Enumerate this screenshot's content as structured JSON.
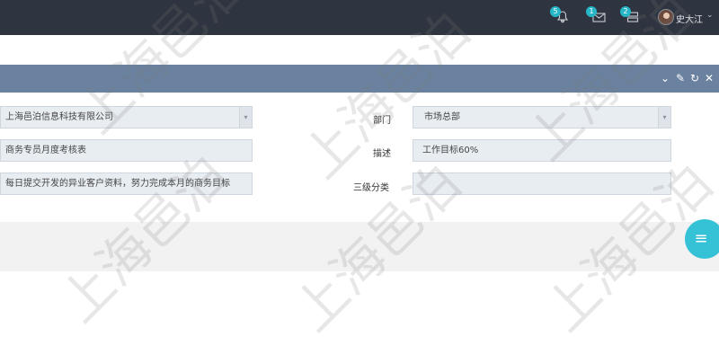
{
  "topbar": {
    "notifications": {
      "icon": "bell-icon",
      "count": "5"
    },
    "messages": {
      "icon": "envelope-icon",
      "count": "1"
    },
    "tasks": {
      "icon": "tasks-icon",
      "count": "2"
    },
    "user": {
      "name": "史大江",
      "caret": "⌄"
    }
  },
  "panel": {
    "tools": {
      "collapse": "⌄",
      "settings": "✎",
      "refresh": "↻",
      "close": "✕"
    }
  },
  "form": {
    "company": {
      "value": "上海邑泊信息科技有限公司"
    },
    "department": {
      "label": "部门",
      "value": "市场总部"
    },
    "name": {
      "value": "商务专员月度考核表"
    },
    "description": {
      "label": "描述",
      "value": "工作目标60%"
    },
    "detail": {
      "value": "每日提交开发的异业客户资料，努力完成本月的商务目标"
    },
    "category3": {
      "label": "三级分类",
      "value": ""
    }
  },
  "fab": {
    "icon": "menu-icon",
    "glyph": "≡"
  },
  "watermark": {
    "text": "上海邑泊"
  },
  "colors": {
    "topbar": "#2f3540",
    "panel_header": "#6a829f",
    "badge": "#27b5c8",
    "fab": "#35c2d6"
  }
}
